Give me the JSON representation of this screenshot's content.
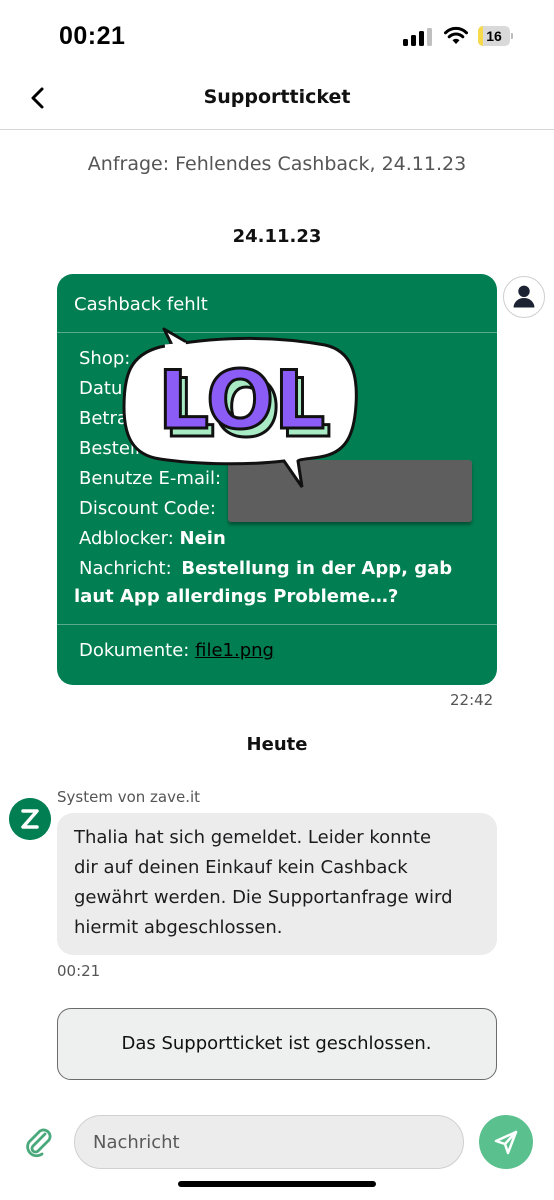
{
  "status_bar": {
    "time": "00:21",
    "battery_level": "16",
    "battery_fill_fraction": 0.16
  },
  "nav": {
    "title": "Supportticket",
    "back_icon": "chevron-left-icon"
  },
  "request_title": "Anfrage: Fehlendes Cashback, 24.11.23",
  "date_separator_1": "24.11.23",
  "ticket": {
    "header": "Cashback fehlt",
    "fields": {
      "shop_label": "Shop:",
      "datum_label": "Datu",
      "betrag_label": "Betra",
      "bestell_label": "Bestell",
      "email_label": "Benutze E-mail:",
      "discount_label": "Discount Code:",
      "adblocker_label": "Adblocker:",
      "adblocker_value": "Nein",
      "nachricht_label": "Nachricht:",
      "nachricht_value": "Bestellung in der App, gab",
      "nachricht_cont": "laut App allerdings Probleme…?"
    },
    "documents_label": "Dokumente:",
    "documents_link": "file1.png",
    "time": "22:42"
  },
  "sticker": {
    "text": "LOL",
    "colors": {
      "fill": "#8b5cf6",
      "shadow": "#a8ebc4",
      "bubble": "#ffffff"
    }
  },
  "date_separator_2": "Heute",
  "system_message": {
    "sender": "System von zave.it",
    "lines": [
      "Thalia  hat sich gemeldet. Leider konnte",
      "dir auf deinen Einkauf kein Cashback",
      "gewährt werden. Die Supportanfrage wird",
      "hiermit abgeschlossen."
    ],
    "time": "00:21"
  },
  "closed_notice": "Das Supportticket ist geschlossen.",
  "input": {
    "placeholder": "Nachricht",
    "attach_icon": "paperclip-icon",
    "send_icon": "send-icon"
  },
  "colors": {
    "ticket_green": "#017f52",
    "send_green": "#59c08e",
    "system_bubble": "#ececec"
  }
}
